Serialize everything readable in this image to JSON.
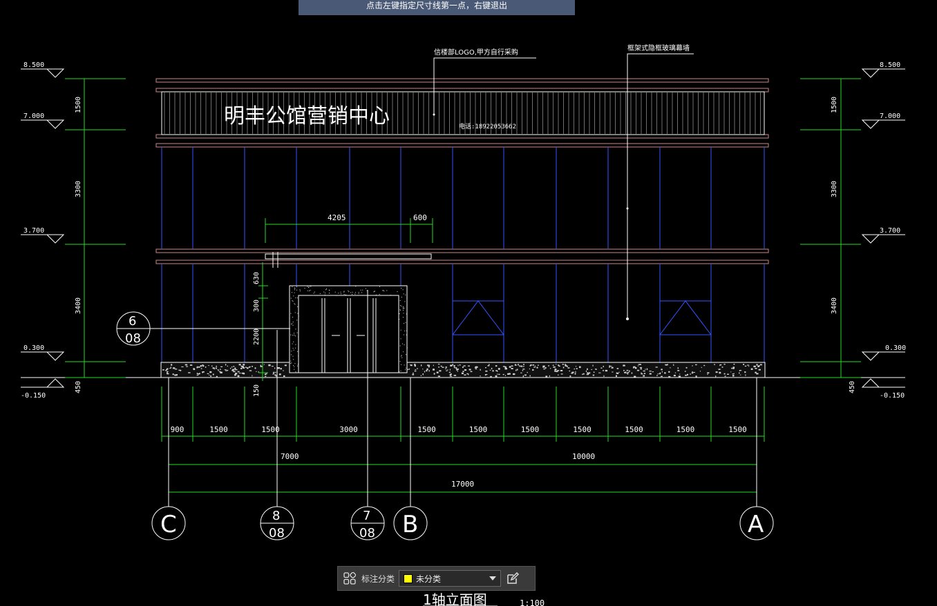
{
  "prompt": {
    "text": "点击左键指定尺寸线第一点，右键退出"
  },
  "drawing": {
    "sign_text": "明丰公馆营销中心",
    "phone_text": "电话:18922053662",
    "note_logo": "信楼部LOGO,甲方自行采购",
    "note_curtain": "框架式隐框玻璃幕墙",
    "title": "1轴立面图",
    "scale": "1:100",
    "colors": {
      "wall": "#3355ff",
      "dim": "#22dd22",
      "line": "#ffffff",
      "band": "#cc8888"
    },
    "elevations_left": [
      "8.500",
      "7.000",
      "3.700",
      "0.300",
      "-0.150"
    ],
    "elevations_right": [
      "8.500",
      "7.000",
      "3.700",
      "0.300",
      "-0.150"
    ],
    "vertical_dims_left": [
      "1500",
      "3300",
      "3400",
      "450"
    ],
    "vertical_dims_right": [
      "1500",
      "3300",
      "3400",
      "450"
    ],
    "door_dims": [
      "630",
      "300",
      "2200",
      "150"
    ],
    "canopy_dims": [
      "4205",
      "600"
    ],
    "bottom_dims": [
      "900",
      "1500",
      "1500",
      "3000",
      "1500",
      "1500",
      "1500",
      "1500",
      "1500",
      "1500",
      "1500"
    ],
    "mid_dims": [
      "7000",
      "10000"
    ],
    "total_dim": "17000",
    "axes": {
      "c": "C",
      "b": "B",
      "a": "A"
    },
    "sections": [
      {
        "top": "6",
        "bottom": "08"
      },
      {
        "top": "8",
        "bottom": "08"
      },
      {
        "top": "7",
        "bottom": "08"
      }
    ]
  },
  "toolbar": {
    "icon": "grid-icon",
    "label": "标注分类",
    "selected": "未分类",
    "swatch_color": "#ffff00",
    "edit_icon": "edit-icon"
  }
}
